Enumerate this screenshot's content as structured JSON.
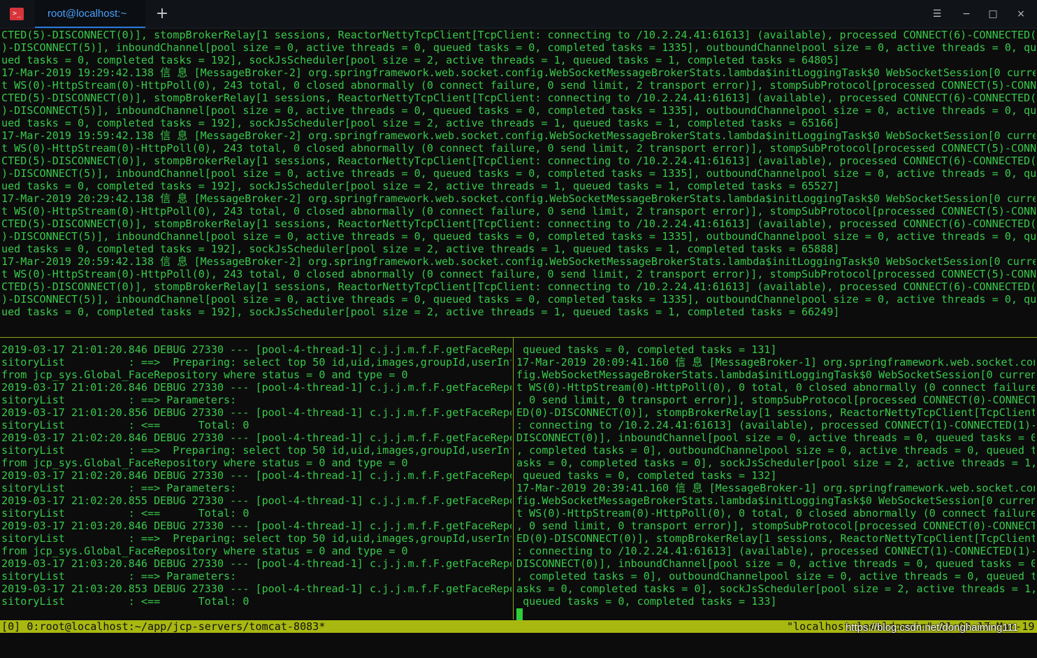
{
  "window": {
    "tab_title": "root@localhost:~",
    "new_tab_glyph": "+",
    "app_icon_glyph": ">_",
    "controls": {
      "menu": "☰",
      "minimize": "−",
      "maximize": "□",
      "close": "×"
    }
  },
  "panes": {
    "top": [
      "CTED(5)-DISCONNECT(0)], stompBrokerRelay[1 sessions, ReactorNettyTcpClient[TcpClient: connecting to /10.2.24.41:61613] (available), processed CONNECT(6)-CONNECTED(6",
      ")-DISCONNECT(5)], inboundChannel[pool size = 0, active threads = 0, queued tasks = 0, completed tasks = 1335], outboundChannelpool size = 0, active threads = 0, que",
      "ued tasks = 0, completed tasks = 192], sockJsScheduler[pool size = 2, active threads = 1, queued tasks = 1, completed tasks = 64805]",
      "17-Mar-2019 19:29:42.138 信 息 [MessageBroker-2] org.springframework.web.socket.config.WebSocketMessageBrokerStats.lambda$initLoggingTask$0 WebSocketSession[0 curren",
      "t WS(0)-HttpStream(0)-HttpPoll(0), 243 total, 0 closed abnormally (0 connect failure, 0 send limit, 2 transport error)], stompSubProtocol[processed CONNECT(5)-CONNE",
      "CTED(5)-DISCONNECT(0)], stompBrokerRelay[1 sessions, ReactorNettyTcpClient[TcpClient: connecting to /10.2.24.41:61613] (available), processed CONNECT(6)-CONNECTED(6",
      ")-DISCONNECT(5)], inboundChannel[pool size = 0, active threads = 0, queued tasks = 0, completed tasks = 1335], outboundChannelpool size = 0, active threads = 0, que",
      "ued tasks = 0, completed tasks = 192], sockJsScheduler[pool size = 2, active threads = 1, queued tasks = 1, completed tasks = 65166]",
      "17-Mar-2019 19:59:42.138 信 息 [MessageBroker-2] org.springframework.web.socket.config.WebSocketMessageBrokerStats.lambda$initLoggingTask$0 WebSocketSession[0 curren",
      "t WS(0)-HttpStream(0)-HttpPoll(0), 243 total, 0 closed abnormally (0 connect failure, 0 send limit, 2 transport error)], stompSubProtocol[processed CONNECT(5)-CONNE",
      "CTED(5)-DISCONNECT(0)], stompBrokerRelay[1 sessions, ReactorNettyTcpClient[TcpClient: connecting to /10.2.24.41:61613] (available), processed CONNECT(6)-CONNECTED(6",
      ")-DISCONNECT(5)], inboundChannel[pool size = 0, active threads = 0, queued tasks = 0, completed tasks = 1335], outboundChannelpool size = 0, active threads = 0, que",
      "ued tasks = 0, completed tasks = 192], sockJsScheduler[pool size = 2, active threads = 1, queued tasks = 1, completed tasks = 65527]",
      "17-Mar-2019 20:29:42.138 信 息 [MessageBroker-2] org.springframework.web.socket.config.WebSocketMessageBrokerStats.lambda$initLoggingTask$0 WebSocketSession[0 curren",
      "t WS(0)-HttpStream(0)-HttpPoll(0), 243 total, 0 closed abnormally (0 connect failure, 0 send limit, 2 transport error)], stompSubProtocol[processed CONNECT(5)-CONNE",
      "CTED(5)-DISCONNECT(0)], stompBrokerRelay[1 sessions, ReactorNettyTcpClient[TcpClient: connecting to /10.2.24.41:61613] (available), processed CONNECT(6)-CONNECTED(6",
      ")-DISCONNECT(5)], inboundChannel[pool size = 0, active threads = 0, queued tasks = 0, completed tasks = 1335], outboundChannelpool size = 0, active threads = 0, que",
      "ued tasks = 0, completed tasks = 192], sockJsScheduler[pool size = 2, active threads = 1, queued tasks = 1, completed tasks = 65888]",
      "17-Mar-2019 20:59:42.138 信 息 [MessageBroker-2] org.springframework.web.socket.config.WebSocketMessageBrokerStats.lambda$initLoggingTask$0 WebSocketSession[0 curren",
      "t WS(0)-HttpStream(0)-HttpPoll(0), 243 total, 0 closed abnormally (0 connect failure, 0 send limit, 2 transport error)], stompSubProtocol[processed CONNECT(5)-CONNE",
      "CTED(5)-DISCONNECT(0)], stompBrokerRelay[1 sessions, ReactorNettyTcpClient[TcpClient: connecting to /10.2.24.41:61613] (available), processed CONNECT(6)-CONNECTED(6",
      ")-DISCONNECT(5)], inboundChannel[pool size = 0, active threads = 0, queued tasks = 0, completed tasks = 1335], outboundChannelpool size = 0, active threads = 0, que",
      "ued tasks = 0, completed tasks = 192], sockJsScheduler[pool size = 2, active threads = 1, queued tasks = 1, completed tasks = 66249]"
    ],
    "left": [
      "2019-03-17 21:01:20.846 DEBUG 27330 --- [pool-4-thread-1] c.j.j.m.f.F.getFaceRepo",
      "sitoryList          : ==>  Preparing: select top 50 id,uid,images,groupId,userInfo",
      "from jcp_sys.Global_FaceRepository where status = 0 and type = 0",
      "2019-03-17 21:01:20.846 DEBUG 27330 --- [pool-4-thread-1] c.j.j.m.f.F.getFaceRepo",
      "sitoryList          : ==> Parameters:",
      "2019-03-17 21:01:20.856 DEBUG 27330 --- [pool-4-thread-1] c.j.j.m.f.F.getFaceRepo",
      "sitoryList          : <==      Total: 0",
      "2019-03-17 21:02:20.846 DEBUG 27330 --- [pool-4-thread-1] c.j.j.m.f.F.getFaceRepo",
      "sitoryList          : ==>  Preparing: select top 50 id,uid,images,groupId,userInfo",
      "from jcp_sys.Global_FaceRepository where status = 0 and type = 0",
      "2019-03-17 21:02:20.846 DEBUG 27330 --- [pool-4-thread-1] c.j.j.m.f.F.getFaceRepo",
      "sitoryList          : ==> Parameters:",
      "2019-03-17 21:02:20.855 DEBUG 27330 --- [pool-4-thread-1] c.j.j.m.f.F.getFaceRepo",
      "sitoryList          : <==      Total: 0",
      "2019-03-17 21:03:20.846 DEBUG 27330 --- [pool-4-thread-1] c.j.j.m.f.F.getFaceRepo",
      "sitoryList          : ==>  Preparing: select top 50 id,uid,images,groupId,userInfo",
      "from jcp_sys.Global_FaceRepository where status = 0 and type = 0",
      "2019-03-17 21:03:20.846 DEBUG 27330 --- [pool-4-thread-1] c.j.j.m.f.F.getFaceRepo",
      "sitoryList          : ==> Parameters:",
      "2019-03-17 21:03:20.853 DEBUG 27330 --- [pool-4-thread-1] c.j.j.m.f.F.getFaceRepo",
      "sitoryList          : <==      Total: 0"
    ],
    "right": [
      " queued tasks = 0, completed tasks = 131]",
      "17-Mar-2019 20:09:41.160 信 息 [MessageBroker-1] org.springframework.web.socket.con",
      "fig.WebSocketMessageBrokerStats.lambda$initLoggingTask$0 WebSocketSession[0 curren",
      "t WS(0)-HttpStream(0)-HttpPoll(0), 0 total, 0 closed abnormally (0 connect failure",
      ", 0 send limit, 0 transport error)], stompSubProtocol[processed CONNECT(0)-CONNECT",
      "ED(0)-DISCONNECT(0)], stompBrokerRelay[1 sessions, ReactorNettyTcpClient[TcpClient",
      ": connecting to /10.2.24.41:61613] (available), processed CONNECT(1)-CONNECTED(1)-",
      "DISCONNECT(0)], inboundChannel[pool size = 0, active threads = 0, queued tasks = 0",
      ", completed tasks = 0], outboundChannelpool size = 0, active threads = 0, queued t",
      "asks = 0, completed tasks = 0], sockJsScheduler[pool size = 2, active threads = 1,",
      " queued tasks = 0, completed tasks = 132]",
      "17-Mar-2019 20:39:41.160 信 息 [MessageBroker-1] org.springframework.web.socket.con",
      "fig.WebSocketMessageBrokerStats.lambda$initLoggingTask$0 WebSocketSession[0 curren",
      "t WS(0)-HttpStream(0)-HttpPoll(0), 0 total, 0 closed abnormally (0 connect failure",
      ", 0 send limit, 0 transport error)], stompSubProtocol[processed CONNECT(0)-CONNECT",
      "ED(0)-DISCONNECT(0)], stompBrokerRelay[1 sessions, ReactorNettyTcpClient[TcpClient",
      ": connecting to /10.2.24.41:61613] (available), processed CONNECT(1)-CONNECTED(1)-",
      "DISCONNECT(0)], inboundChannel[pool size = 0, active threads = 0, queued tasks = 0",
      ", completed tasks = 0], outboundChannelpool size = 0, active threads = 0, queued t",
      "asks = 0, completed tasks = 0], sockJsScheduler[pool size = 2, active threads = 1,",
      " queued tasks = 0, completed tasks = 133]"
    ]
  },
  "status": {
    "left": "[0] 0:root@localhost:~/app/jcp-servers/tomcat-8083*",
    "right": "\"localhost.localdomain\" 21:03 17-Mar-19"
  },
  "watermark": "https://blog.csdn.net/donghaiming111",
  "colors": {
    "terminal_bg": "#0c0c0c",
    "terminal_fg": "#38c94a",
    "status_bg": "#a9b811",
    "tab_accent": "#2a78d8"
  }
}
